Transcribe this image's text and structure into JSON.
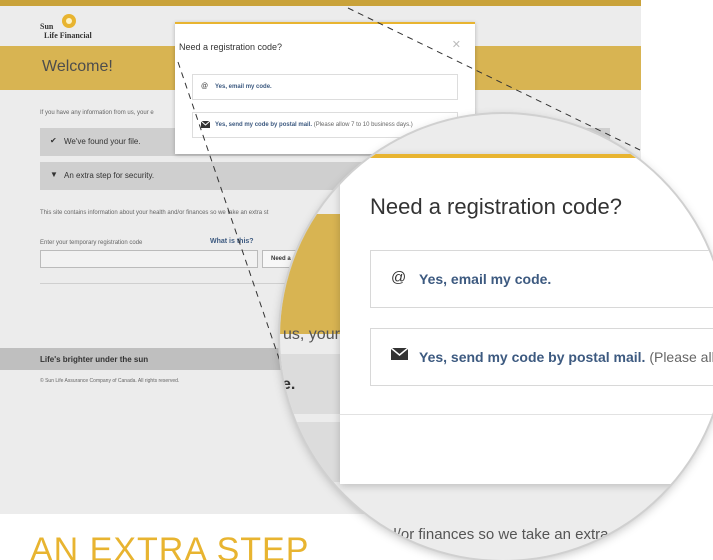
{
  "brand": {
    "logo_line1": "Sun",
    "logo_line2": "Life Financial"
  },
  "page": {
    "welcome": "Welcome!",
    "intro": "If you have any information from us, your e",
    "step1": "We've found your file.",
    "step2": "An extra step for security.",
    "info": "This site contains information about your health and/or finances so we take an extra st",
    "code_label": "Enter your temporary registration code",
    "what_link": "What is this?",
    "need_button": "Need a",
    "footer_tagline": "Life's brighter under the sun",
    "copyright": "© Sun Life Assurance Company of Canada. All rights reserved.",
    "extra_step_heading": "AN EXTRA STEP"
  },
  "modal": {
    "title": "Need a registration code?",
    "close_glyph": "✕",
    "email_option": "Yes, email my code.",
    "mail_option": "Yes, send my code by postal mail.",
    "mail_note": "(Please allow 7 to 10 business days.)",
    "mail_note_zoom": "(Please allov"
  },
  "magnifier": {
    "behind_text_1": "us, your e",
    "behind_fragment_1": "e.",
    "behind_fragment_2": "y.",
    "behind_text_2": "nd/or finances so we take an extra"
  },
  "icons": {
    "at": "@",
    "envelope": "envelope-icon",
    "check": "✔",
    "caret": "▼"
  },
  "colors": {
    "accent": "#e8b430",
    "band": "#d8b452",
    "link": "#3d5a80"
  }
}
